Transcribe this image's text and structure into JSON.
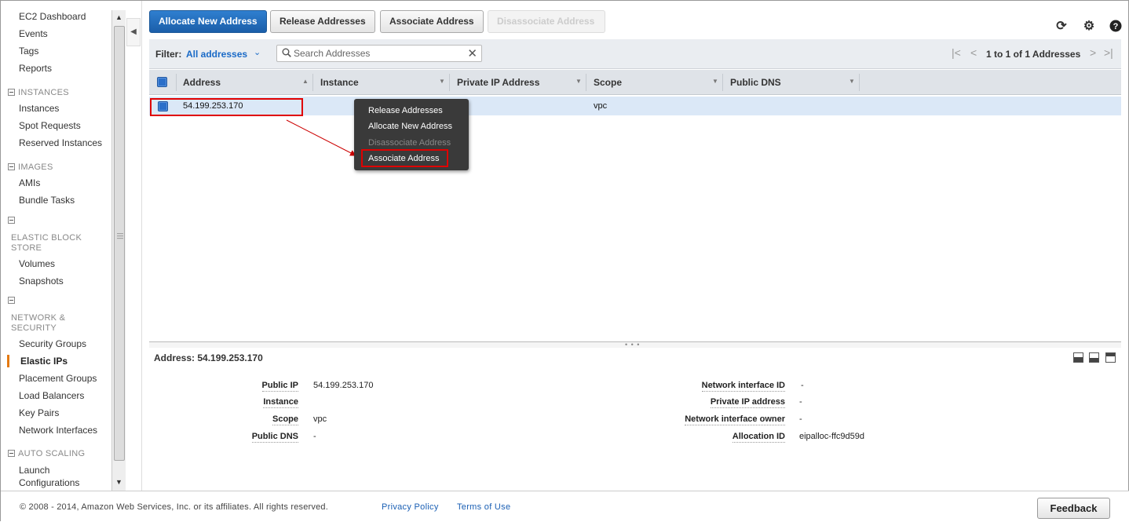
{
  "sidebar": {
    "top_items": [
      "EC2 Dashboard",
      "Events",
      "Tags",
      "Reports"
    ],
    "sections": {
      "instances": {
        "title": "INSTANCES",
        "items": [
          "Instances",
          "Spot Requests",
          "Reserved Instances"
        ]
      },
      "images": {
        "title": "IMAGES",
        "items": [
          "AMIs",
          "Bundle Tasks"
        ]
      },
      "ebs": {
        "title_line1": "ELASTIC BLOCK",
        "title_line2": "STORE",
        "items": [
          "Volumes",
          "Snapshots"
        ]
      },
      "network": {
        "title_line1": "NETWORK &",
        "title_line2": "SECURITY",
        "items": [
          "Security Groups",
          "Elastic IPs",
          "Placement Groups",
          "Load Balancers",
          "Key Pairs",
          "Network Interfaces"
        ]
      },
      "autoscaling": {
        "title": "AUTO SCALING",
        "items": [
          "Launch",
          "Configurations"
        ]
      }
    },
    "active_item": "Elastic IPs"
  },
  "toolbar": {
    "allocate_label": "Allocate New Address",
    "release_label": "Release Addresses",
    "associate_label": "Associate Address",
    "disassociate_label": "Disassociate Address",
    "refresh_icon": "refresh-icon",
    "settings_icon": "gear-icon",
    "help_icon": "help-icon"
  },
  "filter": {
    "label": "Filter:",
    "value": "All addresses",
    "search_placeholder": "Search Addresses",
    "pagination_text": "1 to 1 of 1 Addresses"
  },
  "table": {
    "columns": [
      "Address",
      "Instance",
      "Private IP Address",
      "Scope",
      "Public DNS"
    ],
    "rows": [
      {
        "address": "54.199.253.170",
        "instance": "",
        "private_ip": "",
        "scope": "vpc",
        "public_dns": ""
      }
    ]
  },
  "context_menu": {
    "items": [
      "Release Addresses",
      "Allocate New Address",
      "Disassociate Address",
      "Associate Address"
    ],
    "disabled": [
      "Disassociate Address"
    ],
    "highlighted": "Associate Address"
  },
  "details": {
    "title": "Address: 54.199.253.170",
    "left": [
      {
        "label": "Public IP",
        "value": "54.199.253.170"
      },
      {
        "label": "Instance",
        "value": ""
      },
      {
        "label": "Scope",
        "value": "vpc"
      },
      {
        "label": "Public DNS",
        "value": "-"
      }
    ],
    "right": [
      {
        "label": "Network interface ID",
        "value": "-"
      },
      {
        "label": "Private IP address",
        "value": "-"
      },
      {
        "label": "Network interface owner",
        "value": "-"
      },
      {
        "label": "Allocation ID",
        "value": "eipalloc-ffc9d59d"
      }
    ]
  },
  "footer": {
    "copyright": "© 2008 - 2014, Amazon Web Services, Inc. or its affiliates. All rights reserved.",
    "privacy": "Privacy Policy",
    "terms": "Terms of Use",
    "feedback": "Feedback"
  },
  "colors": {
    "primary_button": "#1b5ea9",
    "link": "#1a6ac7",
    "selected_row": "#dbe8f7",
    "highlight_box": "#e00000",
    "active_nav": "#e47911"
  }
}
